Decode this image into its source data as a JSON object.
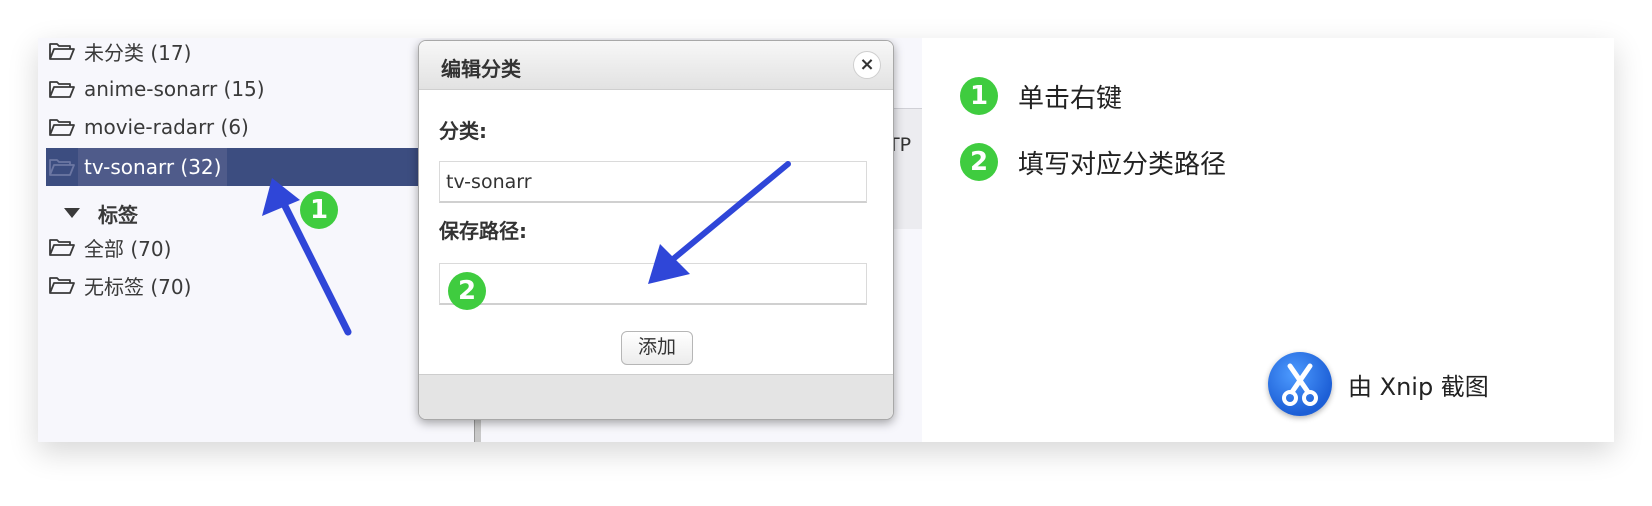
{
  "sidebar": {
    "categories": [
      {
        "label": "未分类 (17)"
      },
      {
        "label": "anime-sonarr (15)"
      },
      {
        "label": "movie-radarr (6)"
      },
      {
        "label": "tv-sonarr (32)"
      }
    ],
    "tags_header": "标签",
    "tags": [
      {
        "label": "全部 (70)"
      },
      {
        "label": "无标签 (70)"
      }
    ]
  },
  "background": {
    "partial_text": "TP :"
  },
  "dialog": {
    "title": "编辑分类",
    "close_glyph": "×",
    "category_label": "分类:",
    "category_value": "tv-sonarr",
    "save_path_label": "保存路径:",
    "save_path_value": "",
    "add_button": "添加"
  },
  "annotations": {
    "badge1": "1",
    "badge2": "2",
    "steps": [
      {
        "number": "1",
        "text": "单击右键"
      },
      {
        "number": "2",
        "text": "填写对应分类路径"
      }
    ],
    "arrow_color": "#2f46d8",
    "badge_color": "#3fcc3f"
  },
  "watermark": {
    "text": "由 Xnip 截图",
    "icon": "scissors-icon"
  },
  "colors": {
    "selected_bg": "#3c4d80"
  }
}
